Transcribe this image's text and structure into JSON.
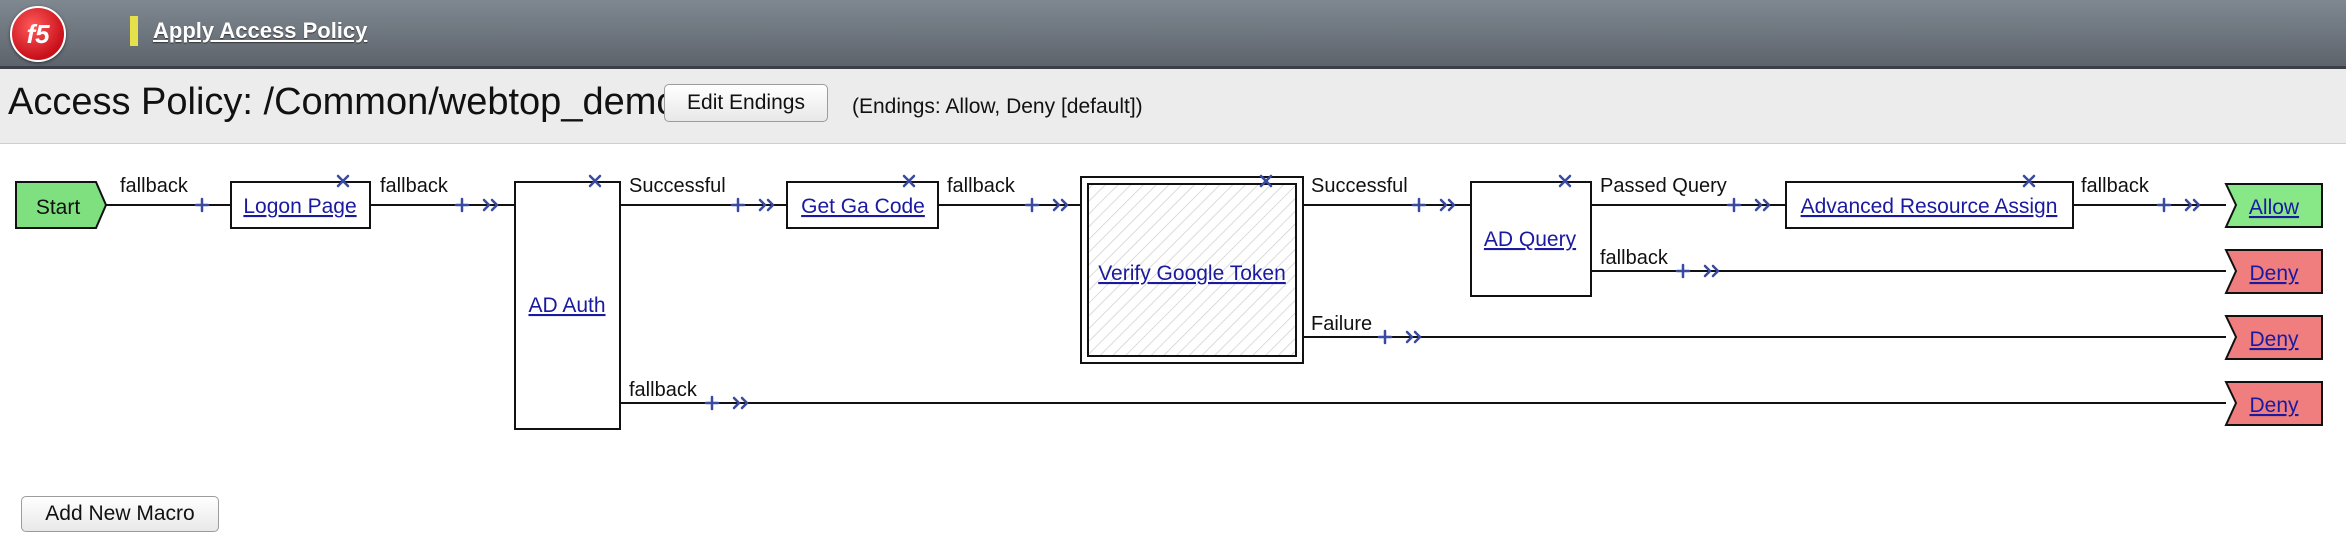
{
  "header": {
    "logo_text": "f5",
    "apply_link": "Apply Access Policy"
  },
  "page": {
    "title": "Access Policy: /Common/webtop_demo",
    "edit_endings_button": "Edit Endings",
    "endings_note": "(Endings: Allow, Deny [default])",
    "add_new_macro_button": "Add New Macro"
  },
  "flow": {
    "start": "Start",
    "nodes": {
      "logon_page": "Logon Page",
      "ad_auth": "AD Auth",
      "get_ga_code": "Get Ga Code",
      "verify_google_token": "Verify Google Token",
      "ad_query": "AD Query",
      "advanced_resource_assign": "Advanced Resource Assign"
    },
    "branches": {
      "start_fallback": "fallback",
      "logon_fallback": "fallback",
      "ad_auth_successful": "Successful",
      "ad_auth_fallback": "fallback",
      "get_ga_fallback": "fallback",
      "verify_successful": "Successful",
      "verify_failure": "Failure",
      "ad_query_passed": "Passed Query",
      "ad_query_fallback": "fallback",
      "ara_fallback": "fallback"
    },
    "endings": {
      "allow": "Allow",
      "deny_1": "Deny",
      "deny_2": "Deny",
      "deny_3": "Deny"
    }
  },
  "colors": {
    "header_bg": "#6b727a",
    "start_fill": "#7fe07f",
    "allow_fill": "#88e888",
    "deny_fill": "#f07e7e",
    "connector_blue": "#3a4aa0",
    "link": "#1a1aa0",
    "apply_marker": "#e6e04a"
  },
  "icons": {
    "remove": "close-icon",
    "add": "plus-icon",
    "arrow": "double-chevron-right-icon"
  }
}
